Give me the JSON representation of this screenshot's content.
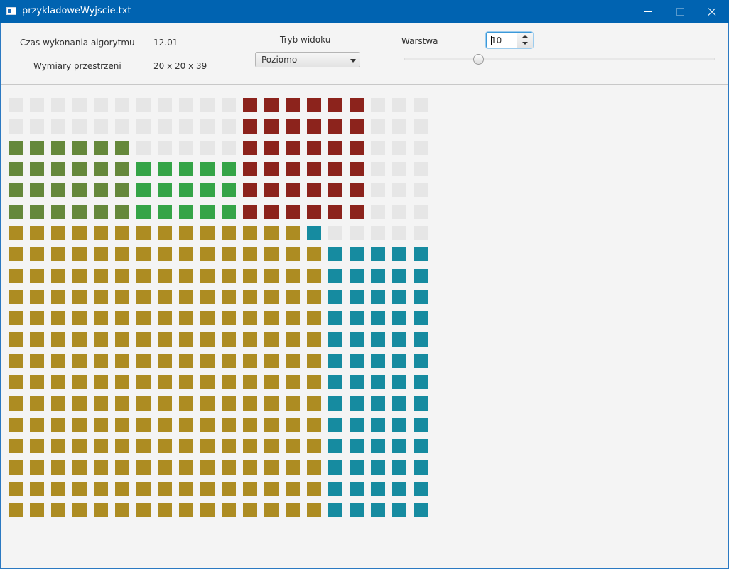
{
  "window": {
    "title": "przykladoweWyjscie.txt",
    "buttons": {
      "minimize": "minimize",
      "maximize": "maximize",
      "close": "close"
    }
  },
  "stats": {
    "time_label": "Czas wykonania algorytmu",
    "time_value": "12.01",
    "dims_label": "Wymiary przestrzeni",
    "dims_value": "20 x 20 x 39"
  },
  "view_mode": {
    "label": "Tryb widoku",
    "selected": "Poziomo"
  },
  "layer": {
    "label": "Warstwa",
    "value": "10",
    "slider_fraction": 0.24
  },
  "colors": {
    "empty": "#e6e6e6",
    "red": "#8c231c",
    "olive": "#65883b",
    "green": "#35a447",
    "gold": "#ad8c22",
    "teal": "#168ba0"
  },
  "grid": {
    "rows": [
      "EEEEEEEEEEERRRRRREEE",
      "EEEEEEEEEEERRRRRREEE",
      "OOOOOOEEEEERRRRRREEE",
      "OOOOOOGGGGGRRRRRREEE",
      "OOOOOOGGGGGRRRRRREEE",
      "OOOOOOGGGGGRRRRRREEE",
      "YYYYYYYYYYYYYYTEEEEEE",
      "YYYYYYYYYYYYYYYTTTTT",
      "YYYYYYYYYYYYYYYTTTTT",
      "YYYYYYYYYYYYYYYTTTTT",
      "YYYYYYYYYYYYYYYTTTTT",
      "YYYYYYYYYYYYYYYTTTTT",
      "YYYYYYYYYYYYYYYTTTTT",
      "YYYYYYYYYYYYYYYTTTTT",
      "YYYYYYYYYYYYYYYTTTTT",
      "YYYYYYYYYYYYYYYTTTTT",
      "YYYYYYYYYYYYYYYTTTTT",
      "YYYYYYYYYYYYYYYTTTTT",
      "YYYYYYYYYYYYYYYTTTTT",
      "YYYYYYYYYYYYYYYTTTTT"
    ]
  }
}
